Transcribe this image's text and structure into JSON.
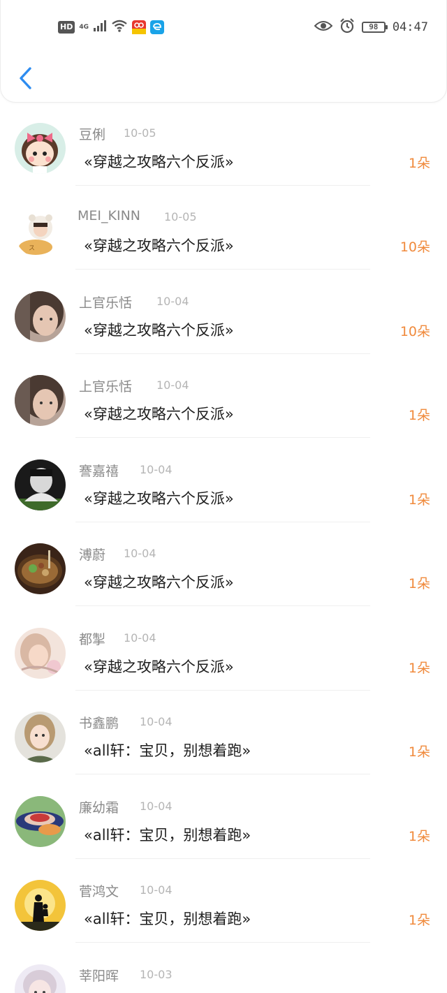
{
  "status_bar": {
    "hd": "HD",
    "network": "4G",
    "battery": "98",
    "time": "04:47"
  },
  "colors": {
    "accent": "#2d8cf0",
    "amount": "#f08a3c",
    "name": "#8a8a8a",
    "date": "#b5b5b5"
  },
  "records": [
    {
      "name": "豆俐",
      "date": "10-05",
      "title": "«穿越之攻略六个反派»",
      "amount": "1朵"
    },
    {
      "name": "MEI_KINN",
      "date": "10-05",
      "title": "«穿越之攻略六个反派»",
      "amount": "10朵"
    },
    {
      "name": "上官乐恬",
      "date": "10-04",
      "title": "«穿越之攻略六个反派»",
      "amount": "10朵"
    },
    {
      "name": "上官乐恬",
      "date": "10-04",
      "title": "«穿越之攻略六个反派»",
      "amount": "1朵"
    },
    {
      "name": "謇嘉禧",
      "date": "10-04",
      "title": "«穿越之攻略六个反派»",
      "amount": "1朵"
    },
    {
      "name": "溥蔚",
      "date": "10-04",
      "title": "«穿越之攻略六个反派»",
      "amount": "1朵"
    },
    {
      "name": "都掣",
      "date": "10-04",
      "title": "«穿越之攻略六个反派»",
      "amount": "1朵"
    },
    {
      "name": "书鑫鹏",
      "date": "10-04",
      "title": "«all轩：宝贝，别想着跑»",
      "amount": "1朵"
    },
    {
      "name": "廉幼霜",
      "date": "10-04",
      "title": "«all轩：宝贝，别想着跑»",
      "amount": "1朵"
    },
    {
      "name": "菅鸿文",
      "date": "10-04",
      "title": "«all轩：宝贝，别想着跑»",
      "amount": "1朵"
    },
    {
      "name": "莘阳晖",
      "date": "10-03",
      "title": "",
      "amount": ""
    }
  ]
}
